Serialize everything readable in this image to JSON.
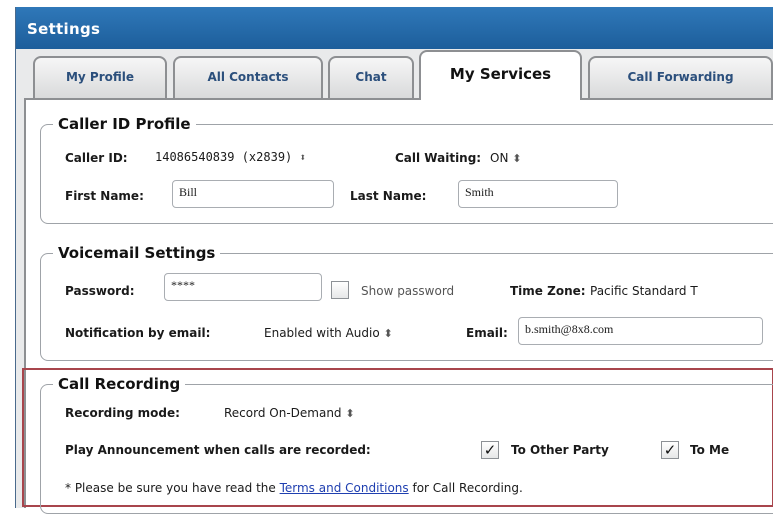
{
  "window": {
    "title": "Settings"
  },
  "tabs": [
    {
      "label": "My Profile",
      "active": false
    },
    {
      "label": "All Contacts",
      "active": false
    },
    {
      "label": "Chat",
      "active": false
    },
    {
      "label": "My Services",
      "active": true
    },
    {
      "label": "Call Forwarding",
      "active": false
    }
  ],
  "caller_id": {
    "legend": "Caller ID Profile",
    "caller_id_label": "Caller ID:",
    "caller_id_value": "14086540839 (x2839)",
    "call_waiting_label": "Call Waiting:",
    "call_waiting_value": "ON",
    "first_name_label": "First Name:",
    "first_name_value": "Bill",
    "last_name_label": "Last Name:",
    "last_name_value": "Smith"
  },
  "voicemail": {
    "legend": "Voicemail Settings",
    "password_label": "Password:",
    "password_value": "****",
    "show_password_label": "Show password",
    "show_password_checked": false,
    "time_zone_label": "Time Zone:",
    "time_zone_value": "Pacific Standard T",
    "notification_label": "Notification by email:",
    "notification_value": "Enabled with Audio",
    "email_label": "Email:",
    "email_value": "b.smith@8x8.com"
  },
  "recording": {
    "legend": "Call Recording",
    "mode_label": "Recording mode:",
    "mode_value": "Record On-Demand",
    "announce_label": "Play Announcement when calls are recorded:",
    "other_party_label": "To Other Party",
    "other_party_checked": true,
    "to_me_label": "To Me",
    "to_me_checked": true,
    "note_prefix": "* Please be sure you have read the",
    "note_link": "Terms and Conditions",
    "note_suffix": "for Call Recording."
  },
  "icons": {
    "select_arrow": "updown-arrow-icon",
    "checkmark": "checkmark-icon"
  },
  "colors": {
    "title_bar": "#1d5e9b",
    "tab_text": "#2b4f7c",
    "highlight_border": "#a8454c",
    "link": "#1f3fb0"
  }
}
